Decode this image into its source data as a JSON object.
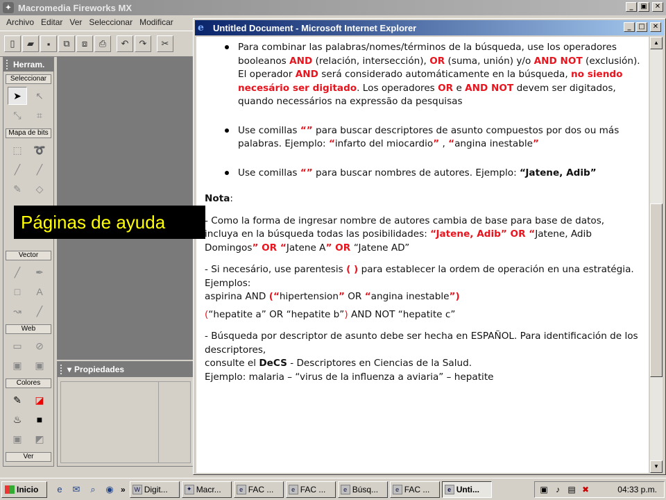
{
  "fireworks": {
    "title": "Macromedia Fireworks MX",
    "menu": [
      "Archivo",
      "Editar",
      "Ver",
      "Seleccionar",
      "Modificar"
    ],
    "tools_panel": {
      "title": "Herram.",
      "sections": [
        "Seleccionar",
        "Mapa de bits",
        "Vector",
        "Web",
        "Colores",
        "Ver"
      ]
    },
    "props_panel": {
      "title": "Propiedades"
    }
  },
  "caption": "Páginas de ayuda",
  "ie": {
    "title": "Untitled Document - Microsoft Internet Explorer",
    "content": {
      "b1": {
        "t1": "Para combinar las palabras/nomes/términos de la búsqueda, use los operadores booleanos ",
        "and1": "AND",
        "t2": " (relación, intersección), ",
        "or1": "OR",
        "t3": " (suma, unión) y/o ",
        "andnot1": "AND NOT",
        "t4": " (exclusión). El operador ",
        "and2": "AND",
        "t5": " será considerado automáticamente en la búsqueda, ",
        "noneed": "no siendo necesário ser digitado",
        "t6": ". Los operadores ",
        "or2": "OR",
        "t7": " e ",
        "andnot2": "AND NOT",
        "t8": " devem ser digitados, quando necessários na expressão da pesquisas"
      },
      "b2": {
        "t1": "Use comillas ",
        "q": "“”",
        "t2": " para buscar descriptores de asunto compuestos por dos ou más palabras. Ejemplo: ",
        "q1": "“",
        "t3": "infarto del miocardio",
        "q2": "”",
        "t4": " , ",
        "q3": "“",
        "t5": "angina inestable",
        "q4": "”"
      },
      "b3": {
        "t1": "Use comillas ",
        "q": "“”",
        "t2": " para buscar nombres de autores. Ejemplo: ",
        "name": "“Jatene, Adib”"
      },
      "nota": "Nota",
      "nota_colon": ":",
      "p1": {
        "t1": "- Como la forma de ingresar nombre de autores cambia de base para base de datos, incluya en la búsqueda todas las posibilidades: ",
        "n1": "“Jatene, Adib”",
        "or1": " OR ",
        "n2q": "“",
        "n2": "Jatene, Adib Domingos",
        "n2e": "”",
        "or2": " OR ",
        "n3q": "“",
        "n3": "Jatene A",
        "n3e": "”",
        "or3": " OR ",
        "n4": "“Jatene AD”"
      },
      "p2": {
        "t1": "- Si necesário, use parentesis ",
        "paren": "( )",
        "t2": " para establecer la ordem de operación en una estratégia. Ejemplos:",
        "ex1_a": "aspirina AND ",
        "ex1_p": "(",
        "ex1_q1": "“",
        "ex1_b": "hipertension",
        "ex1_q2": "”",
        "ex1_c": " OR ",
        "ex1_q3": "“",
        "ex1_d": "angina inestable",
        "ex1_q4": "”",
        "ex1_pe": ")",
        "ex2_p": "(",
        "ex2_a": "“hepatite a” OR “hepatite b”",
        "ex2_pe": ")",
        "ex2_b": " AND NOT “hepatite c”"
      },
      "p3": {
        "t1": "- Búsqueda por descriptor de asunto debe ser hecha en ESPAÑOL. Para identificación de los descriptores,",
        "t2": "consulte el ",
        "decs": "DeCS",
        "t3": " - Descriptores en Ciencias de la Salud.",
        "t4": "Ejemplo: malaria – “virus de la influenza a aviaria” – hepatite"
      }
    }
  },
  "taskbar": {
    "start": "Inicio",
    "more": "»",
    "tasks": [
      "Digit...",
      "Macr...",
      "FAC ...",
      "FAC ...",
      "Búsq...",
      "FAC ...",
      "Unti..."
    ],
    "clock": "04:33 p.m."
  },
  "colors": {
    "accent_red": "#e8141e",
    "caption_text": "#ffff00",
    "ie_title": "#0a246a"
  }
}
